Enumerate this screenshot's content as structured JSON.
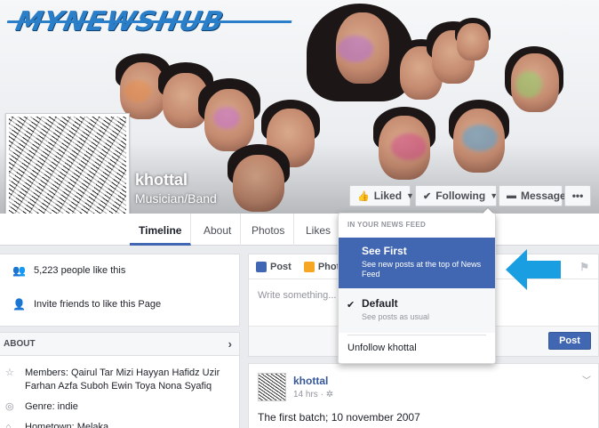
{
  "watermark": {
    "text": "MYNEWSHUB"
  },
  "page": {
    "name": "khottal",
    "category": "Musician/Band"
  },
  "cover_buttons": {
    "liked": "Liked",
    "following": "Following",
    "message": "Message",
    "more": "•••"
  },
  "nav": {
    "tabs": [
      "Timeline",
      "About",
      "Photos",
      "Likes"
    ]
  },
  "left": {
    "likes_count": "5,223 people like this",
    "invite": "Invite friends to like this Page",
    "about_header": "ABOUT",
    "about_items": [
      {
        "icon": "star-icon",
        "text": "Members: Qairul Tar Mizi Hayyan Hafidz Uzir Farhan Azfa Suboh Ewin Toya Nona Syafiq"
      },
      {
        "icon": "genre-icon",
        "text": "Genre: indie"
      },
      {
        "icon": "home-icon",
        "text": "Hometown: Melaka"
      }
    ]
  },
  "composer": {
    "tab_post": "Post",
    "tab_photo": "Photo",
    "placeholder": "Write something...",
    "post_button": "Post"
  },
  "feed_post": {
    "author": "khottal",
    "time": "14 hrs ·",
    "text": "The first batch; 10 november 2007"
  },
  "dropdown": {
    "header": "IN YOUR NEWS FEED",
    "see_first_title": "See First",
    "see_first_sub": "See new posts at the top of News Feed",
    "default_title": "Default",
    "default_sub": "See posts as usual",
    "unfollow": "Unfollow khottal"
  },
  "colors": {
    "accent": "#4267b2",
    "arrow": "#1a9ee2",
    "logo": "#2a7fc8"
  }
}
